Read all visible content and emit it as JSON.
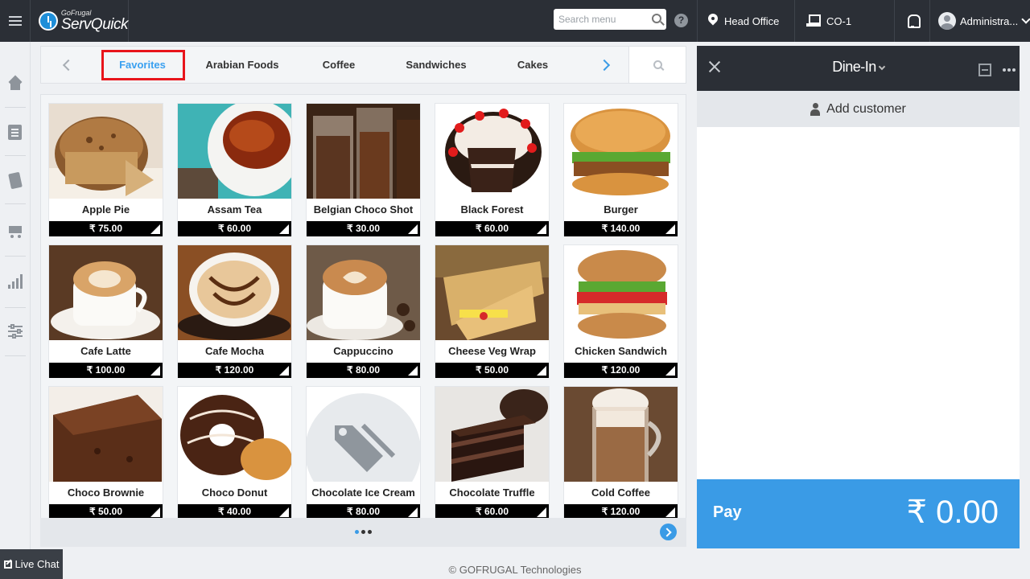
{
  "header": {
    "logo_small": "GoFrugal",
    "logo_big": "ServQuick",
    "search_placeholder": "Search menu",
    "help": "?",
    "location": "Head Office",
    "register": "CO-1",
    "user": "Administra..."
  },
  "categories": {
    "items": [
      "Favorites",
      "Arabian Foods",
      "Coffee",
      "Sandwiches",
      "Cakes"
    ],
    "active": "Favorites"
  },
  "products": [
    {
      "name": "Apple Pie",
      "price": "₹ 75.00",
      "image": "apple-pie"
    },
    {
      "name": "Assam Tea",
      "price": "₹ 60.00",
      "image": "assam-tea"
    },
    {
      "name": "Belgian Choco Shot",
      "price": "₹ 30.00",
      "image": "belgian-choco-shot"
    },
    {
      "name": "Black Forest",
      "price": "₹ 60.00",
      "image": "black-forest"
    },
    {
      "name": "Burger",
      "price": "₹ 140.00",
      "image": "burger"
    },
    {
      "name": "Cafe Latte",
      "price": "₹ 100.00",
      "image": "cafe-latte"
    },
    {
      "name": "Cafe Mocha",
      "price": "₹ 120.00",
      "image": "cafe-mocha"
    },
    {
      "name": "Cappuccino",
      "price": "₹ 80.00",
      "image": "cappuccino"
    },
    {
      "name": "Cheese Veg Wrap",
      "price": "₹ 50.00",
      "image": "cheese-veg-wrap"
    },
    {
      "name": "Chicken Sandwich",
      "price": "₹ 120.00",
      "image": "chicken-sandwich"
    },
    {
      "name": "Choco Brownie",
      "price": "₹ 50.00",
      "image": "choco-brownie"
    },
    {
      "name": "Choco Donut",
      "price": "₹ 40.00",
      "image": "choco-donut"
    },
    {
      "name": "Chocolate Ice Cream",
      "price": "₹ 80.00",
      "image": "placeholder-tag"
    },
    {
      "name": "Chocolate Truffle",
      "price": "₹ 60.00",
      "image": "chocolate-truffle"
    },
    {
      "name": "Cold Coffee",
      "price": "₹ 120.00",
      "image": "cold-coffee"
    }
  ],
  "order": {
    "mode": "Dine-In",
    "add_customer": "Add customer",
    "pay_label": "Pay",
    "total": "₹ 0.00"
  },
  "footer": {
    "copyright": "© GOFRUGAL Technologies",
    "live_chat": "Live Chat"
  },
  "colors": {
    "topbar": "#2b2f36",
    "accent": "#3a9be6",
    "active_tab": "#3aa0f0",
    "highlight": "#e8141b"
  }
}
